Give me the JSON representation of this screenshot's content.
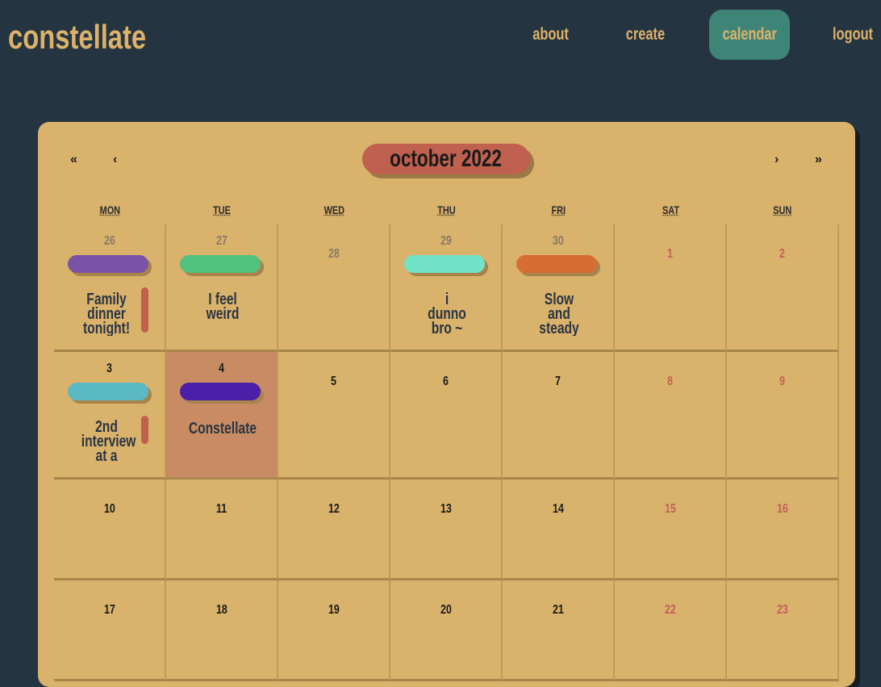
{
  "app": {
    "logo": "constellate"
  },
  "nav": [
    {
      "id": "about",
      "label": "about"
    },
    {
      "id": "create",
      "label": "create"
    },
    {
      "id": "calendar",
      "label": "calendar",
      "active": true
    },
    {
      "id": "logout",
      "label": "logout"
    }
  ],
  "calendar": {
    "month_label": "october 2022",
    "prev_year": "«",
    "prev_month": "‹",
    "next_month": "›",
    "next_year": "»",
    "weekdays": [
      "MON",
      "TUE",
      "WED",
      "THU",
      "FRI",
      "SAT",
      "SUN"
    ],
    "weeks": [
      [
        {
          "day": "26",
          "kind": "other",
          "event": {
            "title": "Family dinner tonight!",
            "color": "#7a52a6",
            "bar": true
          }
        },
        {
          "day": "27",
          "kind": "other",
          "event": {
            "title": "I feel weird",
            "color": "#52c27e"
          }
        },
        {
          "day": "28",
          "kind": "other"
        },
        {
          "day": "29",
          "kind": "other",
          "event": {
            "title": "i dunno bro ~",
            "color": "#72e2c8"
          }
        },
        {
          "day": "30",
          "kind": "other",
          "event": {
            "title": "Slow and steady",
            "color": "#d86d33"
          }
        },
        {
          "day": "1",
          "kind": "weekend"
        },
        {
          "day": "2",
          "kind": "weekend"
        }
      ],
      [
        {
          "day": "3",
          "kind": "normal",
          "event": {
            "title": "2nd interview at a",
            "color": "#5ab9c2",
            "bar": true
          }
        },
        {
          "day": "4",
          "kind": "today",
          "event": {
            "title": "Constellate",
            "color": "#4d1ea8"
          }
        },
        {
          "day": "5",
          "kind": "normal"
        },
        {
          "day": "6",
          "kind": "normal"
        },
        {
          "day": "7",
          "kind": "normal"
        },
        {
          "day": "8",
          "kind": "weekend"
        },
        {
          "day": "9",
          "kind": "weekend"
        }
      ],
      [
        {
          "day": "10",
          "kind": "normal"
        },
        {
          "day": "11",
          "kind": "normal"
        },
        {
          "day": "12",
          "kind": "normal"
        },
        {
          "day": "13",
          "kind": "normal"
        },
        {
          "day": "14",
          "kind": "normal"
        },
        {
          "day": "15",
          "kind": "weekend"
        },
        {
          "day": "16",
          "kind": "weekend"
        }
      ],
      [
        {
          "day": "17",
          "kind": "normal"
        },
        {
          "day": "18",
          "kind": "normal"
        },
        {
          "day": "19",
          "kind": "normal"
        },
        {
          "day": "20",
          "kind": "normal"
        },
        {
          "day": "21",
          "kind": "normal"
        },
        {
          "day": "22",
          "kind": "weekend"
        },
        {
          "day": "23",
          "kind": "weekend"
        }
      ]
    ]
  },
  "colors": {
    "background": "#253441",
    "accent": "#dcb26b",
    "active_nav": "#3f8577",
    "month_pill": "#c0604f",
    "today": "#c98b63"
  }
}
